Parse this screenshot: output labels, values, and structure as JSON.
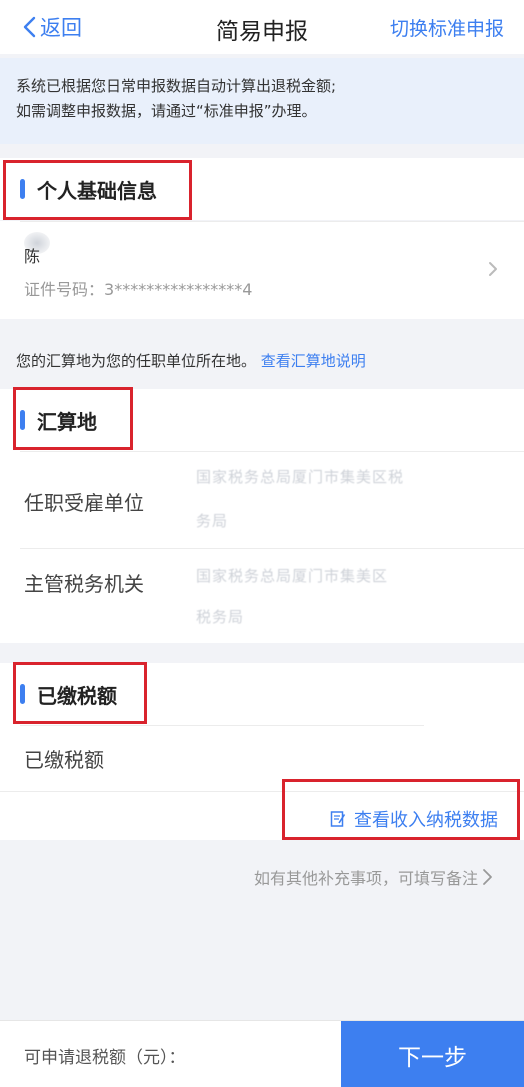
{
  "nav": {
    "back_label": "返回",
    "title": "简易申报",
    "switch_label": "切换标准申报"
  },
  "notice": {
    "line1": "系统已根据您日常申报数据自动计算出退税金额;",
    "line2": "如需调整申报数据，请通过“标准申报”办理。"
  },
  "personal": {
    "heading": "个人基础信息",
    "name": "陈",
    "id_label": "证件号码：",
    "id_value": "3****************4"
  },
  "hint": {
    "text": "您的汇算地为您的任职单位所在地。",
    "link": "查看汇算地说明"
  },
  "settlement": {
    "heading": "汇算地",
    "rows": [
      {
        "label": "任职受雇单位",
        "value_line1": "国家税务总局厦门市集美区税",
        "value_line2": "务局"
      },
      {
        "label": "主管税务机关",
        "value_line1": "国家税务总局厦门市集美区",
        "value_line2": "税务局"
      }
    ]
  },
  "tax_paid": {
    "heading": "已缴税额",
    "row_label": "已缴税额",
    "view_link": "查看收入纳税数据"
  },
  "remark": "如有其他补充事项，可填写备注",
  "footer": {
    "refund_label": "可申请退税额（元）：",
    "next_label": "下一步"
  },
  "colors": {
    "accent": "#3d7ff0",
    "highlight_box": "#d9232d",
    "page_bg": "#f2f3f7",
    "notice_bg": "#e9f0fb"
  }
}
